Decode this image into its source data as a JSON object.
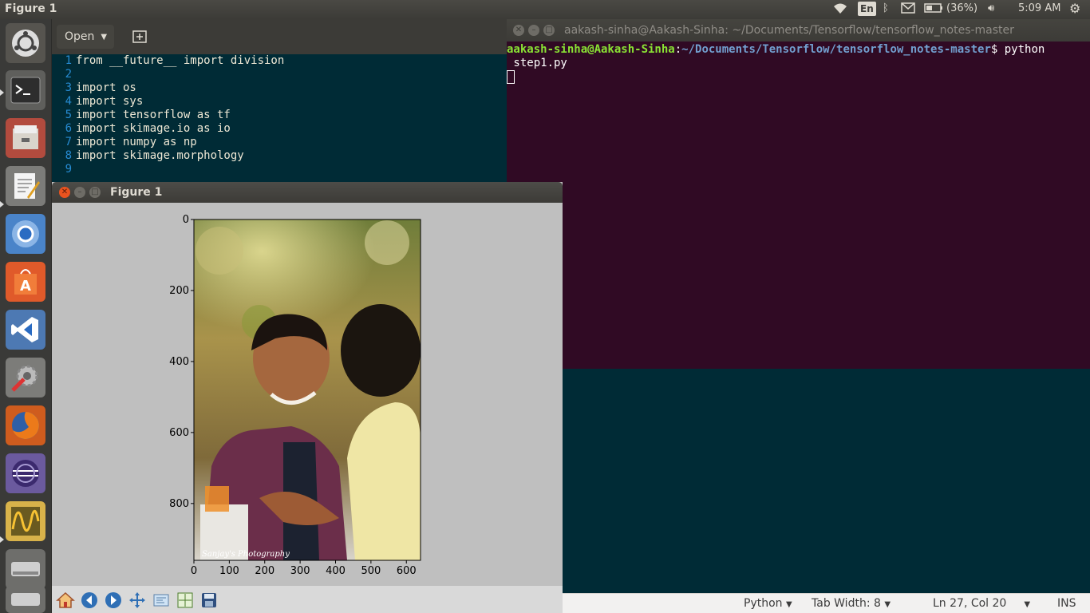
{
  "top_panel": {
    "title": "Figure 1",
    "keyboard": "En",
    "battery": "(36%)",
    "clock": "5:09 AM"
  },
  "launcher": {
    "items": [
      "ubuntu-dash",
      "terminal",
      "files",
      "text-editor",
      "chromium",
      "software-center",
      "vscode",
      "system-settings",
      "firefox",
      "eclipse",
      "oscilloscope",
      "disk-drive",
      "disk-drive-2"
    ]
  },
  "gedit": {
    "open_label": "Open",
    "code_lines": [
      {
        "no": "1",
        "text": "from __future__ import division"
      },
      {
        "no": "2",
        "text": ""
      },
      {
        "no": "3",
        "text": "import os"
      },
      {
        "no": "4",
        "text": "import sys"
      },
      {
        "no": "5",
        "text": "import tensorflow as tf"
      },
      {
        "no": "6",
        "text": "import skimage.io as io"
      },
      {
        "no": "7",
        "text": "import numpy as np"
      },
      {
        "no": "8",
        "text": "import skimage.morphology"
      },
      {
        "no": "9",
        "text": ""
      }
    ],
    "status": {
      "language": "Python",
      "tab_width": "Tab Width: 8",
      "position": "Ln 27, Col 20",
      "mode": "INS"
    }
  },
  "terminal": {
    "title": "aakash-sinha@Aakash-Sinha: ~/Documents/Tensorflow/tensorflow_notes-master",
    "user": "aakash-sinha@Aakash-Sinha",
    "path": "~/Documents/Tensorflow/tensorflow_notes-master",
    "prompt_suffix": "$ python",
    "command_wrap": " step1.py"
  },
  "figure": {
    "title": "Figure 1",
    "image_watermark": "Sanjay's Photography",
    "y_ticks": [
      "0",
      "200",
      "400",
      "600",
      "800"
    ],
    "x_ticks": [
      "0",
      "100",
      "200",
      "300",
      "400",
      "500",
      "600"
    ]
  },
  "chart_data": {
    "type": "image",
    "x": [
      0,
      100,
      200,
      300,
      400,
      500,
      600
    ],
    "y": [
      0,
      200,
      400,
      600,
      800
    ],
    "xlim": [
      0,
      640
    ],
    "ylim": [
      960,
      0
    ]
  }
}
